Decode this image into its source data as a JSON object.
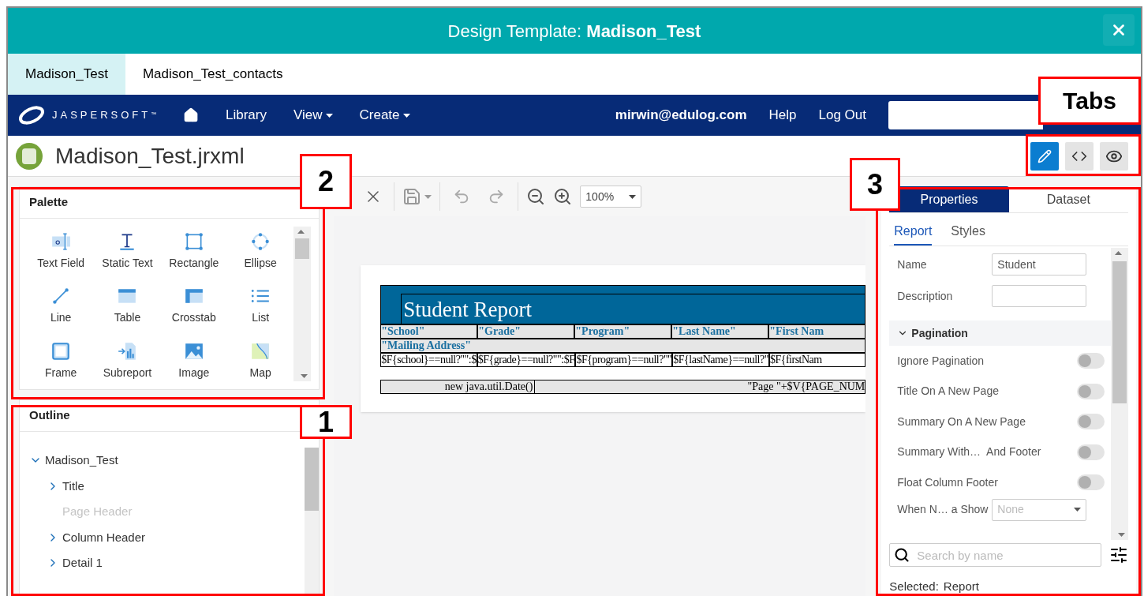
{
  "window": {
    "title_prefix": "Design Template: ",
    "title_bold": "Madison_Test"
  },
  "doc_tabs": [
    {
      "label": "Madison_Test",
      "selected": true
    },
    {
      "label": "Madison_Test_contacts",
      "selected": false
    }
  ],
  "nav": {
    "logo": "JASPERSOFT",
    "tm": "™",
    "items": [
      {
        "label": "Library",
        "dropdown": false
      },
      {
        "label": "View",
        "dropdown": true
      },
      {
        "label": "Create",
        "dropdown": true
      }
    ],
    "user": "mirwin@edulog.com",
    "links": [
      "Help",
      "Log Out"
    ]
  },
  "file": {
    "name": "Madison_Test.jrxml"
  },
  "view_modes": [
    {
      "kind": "edit",
      "selected": true
    },
    {
      "kind": "code",
      "selected": false
    },
    {
      "kind": "preview",
      "selected": false
    }
  ],
  "palette": {
    "title": "Palette",
    "items": [
      {
        "kind": "textfield",
        "label": "Text Field"
      },
      {
        "kind": "statictext",
        "label": "Static Text"
      },
      {
        "kind": "rectangle",
        "label": "Rectangle"
      },
      {
        "kind": "ellipse",
        "label": "Ellipse"
      },
      {
        "kind": "line",
        "label": "Line"
      },
      {
        "kind": "table",
        "label": "Table"
      },
      {
        "kind": "crosstab",
        "label": "Crosstab"
      },
      {
        "kind": "list",
        "label": "List"
      },
      {
        "kind": "frame",
        "label": "Frame"
      },
      {
        "kind": "subreport",
        "label": "Subreport"
      },
      {
        "kind": "image",
        "label": "Image"
      },
      {
        "kind": "map",
        "label": "Map"
      }
    ]
  },
  "outline": {
    "title": "Outline",
    "tree": [
      {
        "label": "Madison_Test",
        "expanded": true,
        "disabled": false,
        "children": [
          {
            "label": "Title",
            "expanded": false,
            "disabled": false
          },
          {
            "label": "Page Header",
            "disabled": true
          },
          {
            "label": "Column Header",
            "expanded": false,
            "disabled": false
          },
          {
            "label": "Detail 1",
            "expanded": false,
            "disabled": false
          }
        ]
      }
    ]
  },
  "toolbar": {
    "zoom": "100%"
  },
  "report": {
    "title": "Student Report",
    "headers": [
      "\"School\"",
      "\"Grade\"",
      "\"Program\"",
      "\"Last Name\"",
      "\"First Nam"
    ],
    "header2": "\"Mailing Address\"",
    "fields": [
      "$F{school}==null?\"\":$",
      "$F{grade}==null?\"\":$F",
      "$F{program}==null?\"\"",
      "$F{lastName}==null?\"",
      "$F{firstNam"
    ],
    "footer_left": "new java.util.Date()",
    "footer_right": "\"Page \"+$V{PAGE_NUM"
  },
  "properties": {
    "tabs": [
      {
        "label": "Properties",
        "selected": true
      },
      {
        "label": "Dataset",
        "selected": false
      }
    ],
    "subtabs": [
      {
        "label": "Report",
        "selected": true
      },
      {
        "label": "Styles",
        "selected": false
      }
    ],
    "fields": [
      {
        "label": "Name",
        "value": "Student"
      },
      {
        "label": "Description"
      }
    ],
    "section": {
      "label": "Pagination",
      "expanded": true
    },
    "toggles": [
      {
        "label": "Ignore Pagination",
        "on": false
      },
      {
        "label": "Title On A New Page",
        "on": false
      },
      {
        "label": "Summary On A New Page",
        "on": false
      },
      {
        "label": "Summary With…  And Footer",
        "on": false
      },
      {
        "label": "Float Column Footer",
        "on": false
      }
    ],
    "select": {
      "label": "When N… a Show",
      "value": "None"
    },
    "search": {
      "placeholder": "Search by name"
    },
    "selected_label": "Selected:",
    "selected_value": "Report"
  },
  "annotations": [
    {
      "kind": "tabs",
      "label": "Tabs"
    },
    {
      "kind": "palette",
      "label": "2"
    },
    {
      "kind": "outline",
      "label": "1"
    },
    {
      "kind": "properties",
      "label": "3"
    }
  ]
}
